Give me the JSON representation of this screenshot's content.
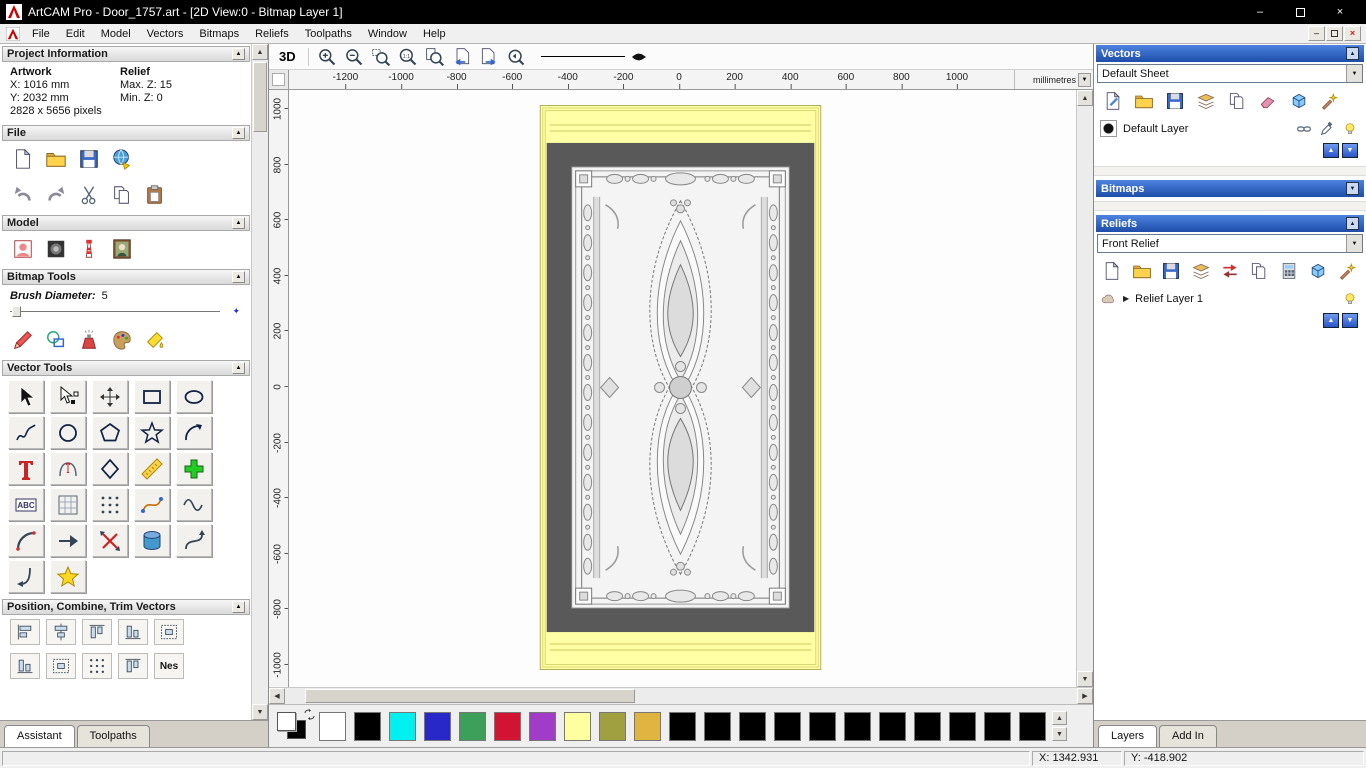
{
  "window": {
    "title": "ArtCAM Pro - Door_1757.art - [2D View:0 - Bitmap Layer 1]"
  },
  "menubar": {
    "items": [
      "File",
      "Edit",
      "Model",
      "Vectors",
      "Bitmaps",
      "Reliefs",
      "Toolpaths",
      "Window",
      "Help"
    ]
  },
  "assistant": {
    "sections": {
      "project": "Project Information",
      "file": "File",
      "model": "Model",
      "bitmap_tools": "Bitmap Tools",
      "vector_tools": "Vector Tools",
      "position": "Position, Combine, Trim Vectors"
    },
    "project_info": {
      "artwork_label": "Artwork",
      "relief_label": "Relief",
      "x": "X: 1016 mm",
      "y": "Y: 2032 mm",
      "pixels": "2828 x 5656 pixels",
      "max_z": "Max. Z: 15",
      "min_z": "Min. Z: 0"
    },
    "brush": {
      "label": "Brush Diameter:",
      "value": "5"
    },
    "file_icons_row1": [
      {
        "n": "new-model-icon",
        "i": "page"
      },
      {
        "n": "open-model-icon",
        "i": "folder"
      },
      {
        "n": "save-model-icon",
        "i": "disk"
      },
      {
        "n": "export-model-icon",
        "i": "globe"
      }
    ],
    "file_icons_row2": [
      {
        "n": "undo-icon",
        "i": "undo"
      },
      {
        "n": "redo-icon",
        "i": "redo"
      },
      {
        "n": "cut-icon",
        "i": "cut"
      },
      {
        "n": "copy-icon",
        "i": "copy"
      },
      {
        "n": "paste-icon",
        "i": "paste"
      }
    ],
    "model_icons": [
      {
        "n": "adjust-model-icon",
        "i": "model"
      },
      {
        "n": "invert-model-icon",
        "i": "texture"
      },
      {
        "n": "model-lighthouse-icon",
        "i": "lighthouse"
      },
      {
        "n": "load-image-icon",
        "i": "monalisa"
      }
    ],
    "paint_icons": [
      {
        "n": "paint-pencil-icon",
        "i": "pencil"
      },
      {
        "n": "draw-shapes-icon",
        "i": "draw"
      },
      {
        "n": "airbrush-icon",
        "i": "spray"
      },
      {
        "n": "colour-palette-icon",
        "i": "palette"
      },
      {
        "n": "flood-fill-icon",
        "i": "flood"
      }
    ],
    "vector_tools": [
      {
        "n": "select-tool",
        "i": "cursor"
      },
      {
        "n": "node-editing-tool",
        "i": "nodesel"
      },
      {
        "n": "transform-tool",
        "i": "transform"
      },
      {
        "n": "rectangle-tool",
        "i": "rect"
      },
      {
        "n": "ellipse-tool",
        "i": "ellipse"
      },
      {
        "n": "polyline-tool",
        "i": "polyline"
      },
      {
        "n": "circle-tool",
        "i": "circle"
      },
      {
        "n": "polygon-tool",
        "i": "polygon"
      },
      {
        "n": "star-tool",
        "i": "star"
      },
      {
        "n": "arc-tool",
        "i": "arc"
      },
      {
        "n": "text-tool",
        "i": "text"
      },
      {
        "n": "text-on-curve-tool",
        "i": "wraptext"
      },
      {
        "n": "diamond-tool",
        "i": "diamond"
      },
      {
        "n": "measure-tool",
        "i": "measure"
      },
      {
        "n": "block-paste-tool",
        "i": "pluscross"
      },
      {
        "n": "text-block-tool",
        "i": "abc"
      },
      {
        "n": "grid-tool",
        "i": "gridframe"
      },
      {
        "n": "point-array-tool",
        "i": "dotgrid"
      },
      {
        "n": "fit-arcs-tool",
        "i": "bezier"
      },
      {
        "n": "fit-beziers-tool",
        "i": "wave"
      },
      {
        "n": "arc-fit-tool",
        "i": "arcseg"
      },
      {
        "n": "line-fit-tool",
        "i": "arrowline"
      },
      {
        "n": "trim-vectors-tool",
        "i": "breakx"
      },
      {
        "n": "offset-tool",
        "i": "cylinder"
      },
      {
        "n": "spline-tool",
        "i": "spline"
      },
      {
        "n": "close-vector-tool",
        "i": "curvej"
      },
      {
        "n": "vector-doctor-tool",
        "i": "staryellow"
      }
    ],
    "position_icons": [
      {
        "n": "align-left-tool",
        "i": "alignl"
      },
      {
        "n": "align-centre-tool",
        "i": "alignc"
      },
      {
        "n": "align-top-tool",
        "i": "aligntop"
      },
      {
        "n": "align-bottom-tool",
        "i": "alignb"
      },
      {
        "n": "align-centres-tool",
        "i": "aligncc"
      }
    ],
    "position_icons2": [
      {
        "n": "combine-union-tool",
        "i": "alignb"
      },
      {
        "n": "combine-subtract-tool",
        "i": "aligncc"
      },
      {
        "n": "slice-tool",
        "i": "dotgrid"
      },
      {
        "n": "scatter-tool",
        "i": "aligntop"
      },
      {
        "n": "nesting-tool",
        "t": "Nes"
      }
    ],
    "tabs": [
      {
        "label": "Assistant",
        "active": true
      },
      {
        "label": "Toolpaths",
        "active": false
      }
    ]
  },
  "canvas": {
    "toolbar": {
      "view_3d": "3D",
      "icons": [
        {
          "n": "zoom-in-icon",
          "i": "zoomin"
        },
        {
          "n": "zoom-out-icon",
          "i": "zoomout"
        },
        {
          "n": "zoom-box-icon",
          "i": "zoomrect"
        },
        {
          "n": "zoom-1to1-icon",
          "i": "zoom11"
        },
        {
          "n": "zoom-fit-icon",
          "i": "zoomfit"
        },
        {
          "n": "previous-bitmap-layer-icon",
          "i": "pageleft"
        },
        {
          "n": "next-bitmap-layer-icon",
          "i": "pageright"
        },
        {
          "n": "zoom-previous-icon",
          "i": "zoomback"
        }
      ]
    },
    "ruler": {
      "units": "millimetres",
      "h_values": [
        -1200,
        -1000,
        -800,
        -600,
        -400,
        -200,
        0,
        200,
        400,
        600,
        800,
        1000
      ],
      "v_values": [
        1000,
        800,
        600,
        400,
        200,
        0,
        -200,
        -400,
        -600,
        -800,
        -1000
      ]
    }
  },
  "palette": {
    "primary": "#ffffff",
    "secondary": "#000000",
    "swatches": [
      "#ffffff",
      "#000000",
      "#00f0f0",
      "#2828c8",
      "#3ca05a",
      "#d01432",
      "#a03cc8",
      "#ffffa0",
      "#a0a040",
      "#e0b440",
      "#000000",
      "#000000",
      "#000000",
      "#000000",
      "#000000",
      "#000000",
      "#000000",
      "#000000",
      "#000000",
      "#000000",
      "#000000"
    ]
  },
  "layers_panel": {
    "vectors": {
      "header": "Vectors",
      "sheet_select": "Default Sheet",
      "toolbar": [
        {
          "n": "new-vector-layer-icon",
          "i": "pageblue"
        },
        {
          "n": "open-vector-layer-icon",
          "i": "folder"
        },
        {
          "n": "save-vector-layer-icon",
          "i": "disk"
        },
        {
          "n": "merge-layers-icon",
          "i": "stack"
        },
        {
          "n": "copy-layer-icon",
          "i": "copy"
        },
        {
          "n": "delete-layer-icon",
          "i": "eraser"
        },
        {
          "n": "toggle-all-icon",
          "i": "cube"
        },
        {
          "n": "layer-wizard-icon",
          "i": "wand"
        }
      ],
      "layer": {
        "name": "Default Layer",
        "color": "#000000"
      }
    },
    "bitmaps": {
      "header": "Bitmaps"
    },
    "reliefs": {
      "header": "Reliefs",
      "relief_select": "Front Relief",
      "toolbar": [
        {
          "n": "new-relief-layer-icon",
          "i": "page"
        },
        {
          "n": "open-relief-layer-icon",
          "i": "folder"
        },
        {
          "n": "save-relief-layer-icon",
          "i": "disk"
        },
        {
          "n": "merge-relief-icon",
          "i": "stack"
        },
        {
          "n": "transfer-relief-icon",
          "i": "redtransfer"
        },
        {
          "n": "copy-relief-icon",
          "i": "copy"
        },
        {
          "n": "calculate-relief-icon",
          "i": "calc"
        },
        {
          "n": "relief-cube-icon",
          "i": "cube"
        },
        {
          "n": "relief-wizard-icon",
          "i": "wand"
        }
      ],
      "layer": {
        "name": "Relief Layer 1"
      }
    },
    "tabs": [
      {
        "label": "Layers",
        "active": true
      },
      {
        "label": "Add In",
        "active": false
      }
    ]
  },
  "statusbar": {
    "x": "X: 1342.931",
    "y": "Y: -418.902"
  }
}
